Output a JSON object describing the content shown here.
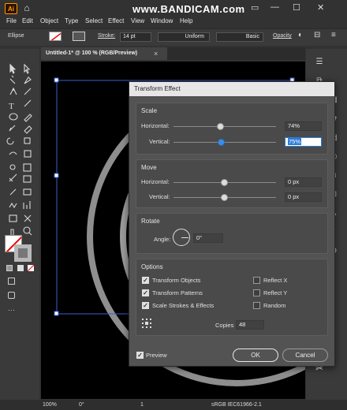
{
  "app": {
    "logo": "Ai",
    "watermark": "www.BANDICAM.com"
  },
  "menu": [
    "File",
    "Edit",
    "Object",
    "Type",
    "Select",
    "Effect",
    "View",
    "Window",
    "Help"
  ],
  "control_bar": {
    "tool_name": "Ellipse",
    "stroke_label": "Stroke:",
    "stroke_value": "14 pt",
    "profile": "Uniform",
    "brush": "Basic",
    "opacity_label": "Opacity"
  },
  "document_tab": {
    "title": "Untitled-1* @ 100 % (RGB/Preview)",
    "close": "×"
  },
  "status": {
    "zoom": "100%",
    "rotation": "0°",
    "page": "1",
    "color_profile": "sRGB IEC61966-2.1"
  },
  "dialog": {
    "title": "Transform Effect",
    "scale": {
      "title": "Scale",
      "horizontal_label": "Horizontal:",
      "horizontal_value": "74%",
      "horizontal_level": 0.74,
      "vertical_label": "Vertical:",
      "vertical_value": "75%",
      "vertical_level": 0.75
    },
    "move": {
      "title": "Move",
      "horizontal_label": "Horizontal:",
      "horizontal_value": "0 px",
      "vertical_label": "Vertical:",
      "vertical_value": "0 px"
    },
    "rotate": {
      "title": "Rotate",
      "angle_label": "Angle:",
      "angle_value": "0°"
    },
    "options": {
      "title": "Options",
      "transform_objects": "Transform Objects",
      "transform_patterns": "Transform Patterns",
      "scale_strokes": "Scale Strokes & Effects",
      "reflect_x": "Reflect X",
      "reflect_y": "Reflect Y",
      "random": "Random",
      "checked": {
        "transform_objects": true,
        "transform_patterns": true,
        "scale_strokes": true,
        "reflect_x": false,
        "reflect_y": false,
        "random": false
      }
    },
    "copies_label": "Copies",
    "copies_value": "48",
    "preview_label": "Preview",
    "preview_checked": true,
    "ok": "OK",
    "cancel": "Cancel"
  }
}
